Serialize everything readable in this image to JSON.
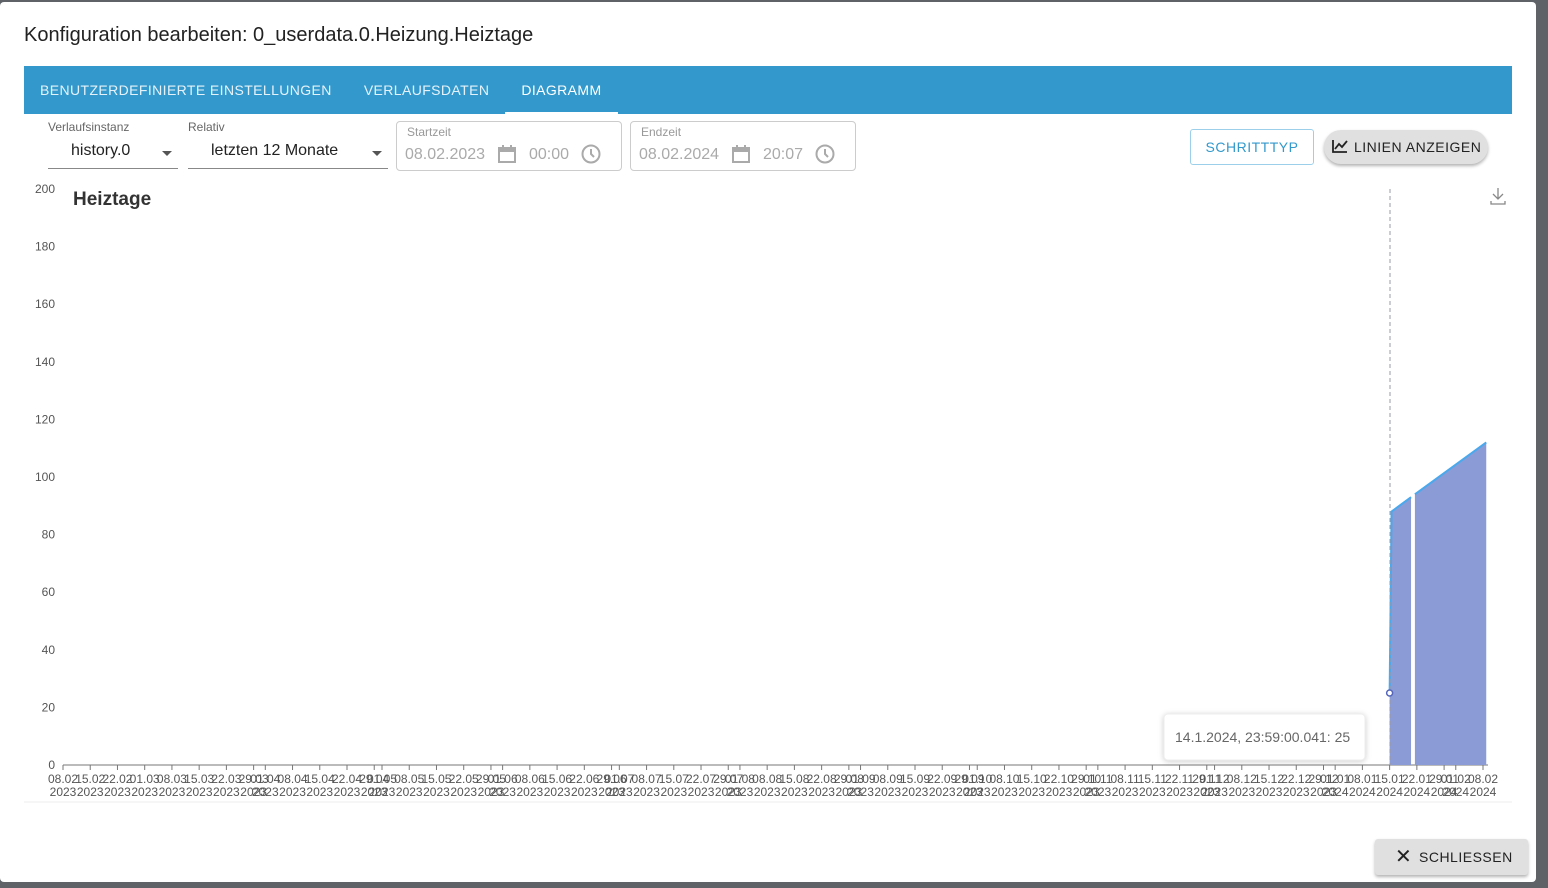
{
  "dialog": {
    "title": "Konfiguration bearbeiten: 0_userdata.0.Heizung.Heiztage",
    "tabs": [
      {
        "label": "BENUTZERDEFINIERTE EINSTELLUNGEN"
      },
      {
        "label": "VERLAUFSDATEN"
      },
      {
        "label": "DIAGRAMM"
      }
    ],
    "close_label": "SCHLIESSEN"
  },
  "controls": {
    "instance": {
      "label": "Verlaufsinstanz",
      "value": "history.0"
    },
    "relative": {
      "label": "Relativ",
      "value": "letzten 12 Monate"
    },
    "start": {
      "label": "Startzeit",
      "date": "08.02.2023",
      "time": "00:00"
    },
    "end": {
      "label": "Endzeit",
      "date": "08.02.2024",
      "time": "20:07"
    },
    "step_label": "SCHRITTTYP",
    "lines_label": "LINIEN ANZEIGEN"
  },
  "colors": {
    "accent": "#3399cc",
    "area": "#8a9bd6",
    "line": "#4aa8ec"
  },
  "chart_data": {
    "type": "area",
    "title": "Heiztage",
    "ylim": [
      0,
      200
    ],
    "yticks": [
      0,
      20,
      40,
      60,
      80,
      100,
      120,
      140,
      160,
      180,
      200
    ],
    "xrange": [
      "2023-02-08",
      "2024-02-08"
    ],
    "xticks": [
      "08.02.2023",
      "15.02.2023",
      "22.02.2023",
      "01.03.2023",
      "08.03.2023",
      "15.03.2023",
      "22.03.2023",
      "29.03.2023",
      "01.04.2023",
      "08.04.2023",
      "15.04.2023",
      "22.04.2023",
      "29.04.2023",
      "01.05.2023",
      "08.05.2023",
      "15.05.2023",
      "22.05.2023",
      "29.05.2023",
      "01.06.2023",
      "08.06.2023",
      "15.06.2023",
      "22.06.2023",
      "29.06.2023",
      "01.07.2023",
      "08.07.2023",
      "15.07.2023",
      "22.07.2023",
      "29.07.2023",
      "01.08.2023",
      "08.08.2023",
      "15.08.2023",
      "22.08.2023",
      "29.08.2023",
      "01.09.2023",
      "08.09.2023",
      "15.09.2023",
      "22.09.2023",
      "29.09.2023",
      "01.10.2023",
      "08.10.2023",
      "15.10.2023",
      "22.10.2023",
      "29.10.2023",
      "01.11.2023",
      "08.11.2023",
      "15.11.2023",
      "22.11.2023",
      "29.11.2023",
      "01.12.2023",
      "08.12.2023",
      "15.12.2023",
      "22.12.2023",
      "29.12.2023",
      "01.01.2024",
      "08.01.2024",
      "15.01.2024",
      "22.01.2024",
      "29.01.2024",
      "01.02.2024",
      "08.02.2024"
    ],
    "segments": [
      [
        [
          "2024-01-14T23:59",
          25
        ],
        [
          "2024-01-15T12:00",
          88
        ],
        [
          "2024-01-20T12:00",
          93
        ]
      ],
      [
        [
          "2024-01-21T12:00",
          94
        ],
        [
          "2024-02-08T20:00",
          112
        ]
      ]
    ],
    "tooltip": "14.1.2024, 23:59:00.041: 25"
  }
}
